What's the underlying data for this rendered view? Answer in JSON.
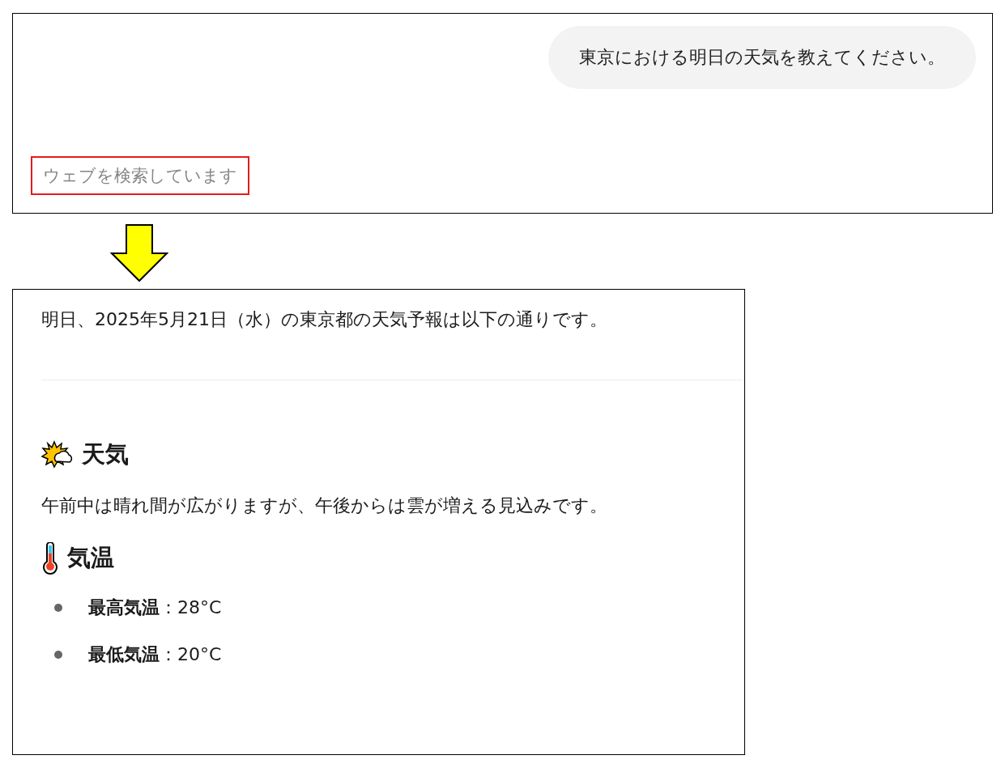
{
  "before": {
    "user_message": "東京における明日の天気を教えてください。",
    "status": "ウェブを検索しています",
    "status_highlighted": true
  },
  "after": {
    "intro": "明日、2025年5月21日（水）の東京都の天気予報は以下の通りです。",
    "sections": [
      {
        "kind": "weather",
        "heading": "天気",
        "body": "午前中は晴れ間が広がりますが、午後からは雲が増える見込みです。"
      },
      {
        "kind": "temperature",
        "heading": "気温",
        "items": [
          "**最高気温**：28°C",
          "**最低気温**：20°C"
        ]
      }
    ]
  }
}
